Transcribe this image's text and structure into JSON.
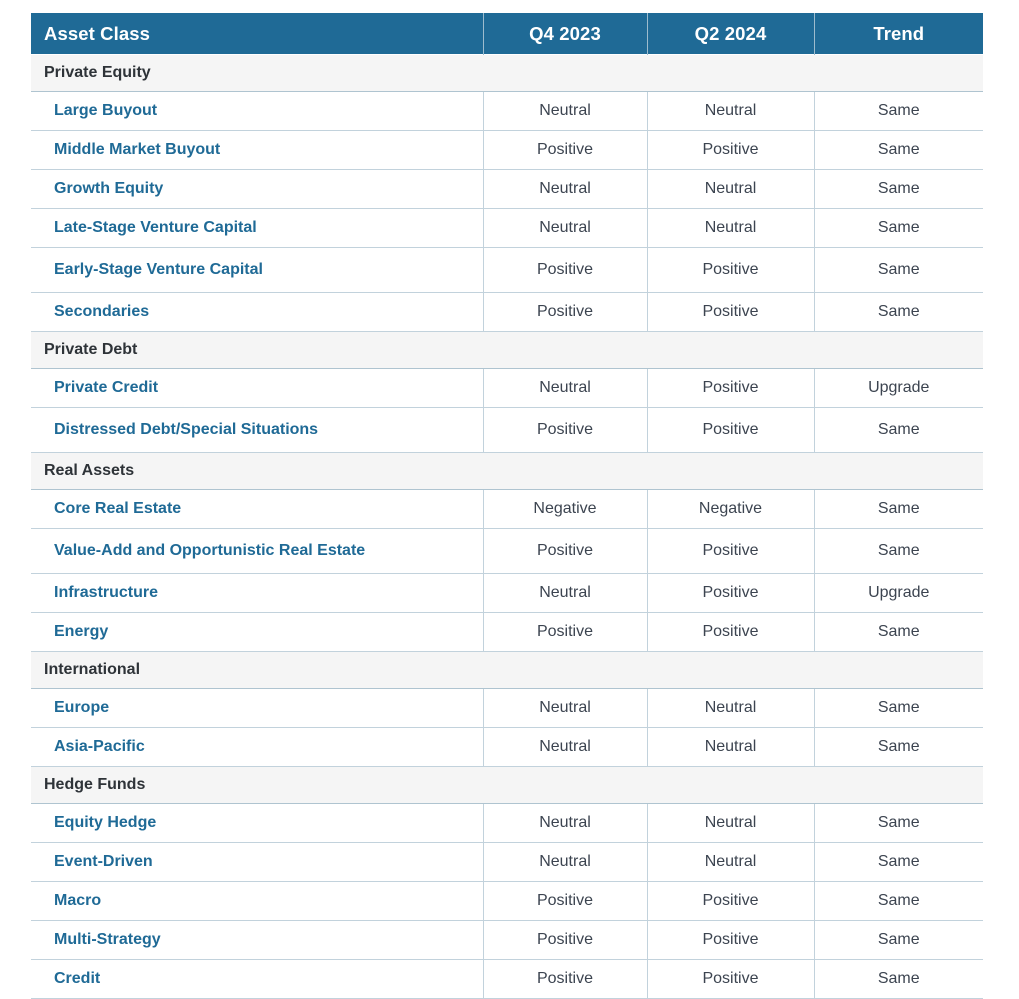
{
  "table": {
    "columns": [
      "Asset Class",
      "Q4 2023",
      "Q2 2024",
      "Trend"
    ],
    "header": {
      "asset_class": "Asset Class",
      "q4_2023": "Q4 2023",
      "q2_2024": "Q2 2024",
      "trend": "Trend"
    },
    "colors": {
      "header_background": "#1F6A96",
      "header_text": "#FFFFFF",
      "category_background": "#F5F5F5",
      "category_text": "#2E3338",
      "item_text": "#1F6A96",
      "value_text": "#3C4450",
      "row_border": "#C2D2DC"
    },
    "groups": [
      {
        "name": "Private Equity",
        "rows": [
          {
            "asset_class": "Large Buyout",
            "q4_2023": "Neutral",
            "q2_2024": "Neutral",
            "trend": "Same"
          },
          {
            "asset_class": "Middle Market Buyout",
            "q4_2023": "Positive",
            "q2_2024": "Positive",
            "trend": "Same"
          },
          {
            "asset_class": "Growth Equity",
            "q4_2023": "Neutral",
            "q2_2024": "Neutral",
            "trend": "Same"
          },
          {
            "asset_class": "Late-Stage Venture Capital",
            "q4_2023": "Neutral",
            "q2_2024": "Neutral",
            "trend": "Same"
          },
          {
            "asset_class": "Early-Stage Venture Capital",
            "q4_2023": "Positive",
            "q2_2024": "Positive",
            "trend": "Same"
          },
          {
            "asset_class": "Secondaries",
            "q4_2023": "Positive",
            "q2_2024": "Positive",
            "trend": "Same"
          }
        ]
      },
      {
        "name": "Private Debt",
        "rows": [
          {
            "asset_class": "Private Credit",
            "q4_2023": "Neutral",
            "q2_2024": "Positive",
            "trend": "Upgrade"
          },
          {
            "asset_class": "Distressed Debt/Special Situations",
            "q4_2023": "Positive",
            "q2_2024": "Positive",
            "trend": "Same"
          }
        ]
      },
      {
        "name": "Real Assets",
        "rows": [
          {
            "asset_class": "Core Real Estate",
            "q4_2023": "Negative",
            "q2_2024": "Negative",
            "trend": "Same"
          },
          {
            "asset_class": "Value-Add and Opportunistic Real Estate",
            "q4_2023": "Positive",
            "q2_2024": "Positive",
            "trend": "Same"
          },
          {
            "asset_class": "Infrastructure",
            "q4_2023": "Neutral",
            "q2_2024": "Positive",
            "trend": "Upgrade"
          },
          {
            "asset_class": "Energy",
            "q4_2023": "Positive",
            "q2_2024": "Positive",
            "trend": "Same"
          }
        ]
      },
      {
        "name": "International",
        "rows": [
          {
            "asset_class": "Europe",
            "q4_2023": "Neutral",
            "q2_2024": "Neutral",
            "trend": "Same"
          },
          {
            "asset_class": "Asia-Pacific",
            "q4_2023": "Neutral",
            "q2_2024": "Neutral",
            "trend": "Same"
          }
        ]
      },
      {
        "name": "Hedge Funds",
        "rows": [
          {
            "asset_class": "Equity Hedge",
            "q4_2023": "Neutral",
            "q2_2024": "Neutral",
            "trend": "Same"
          },
          {
            "asset_class": "Event-Driven",
            "q4_2023": "Neutral",
            "q2_2024": "Neutral",
            "trend": "Same"
          },
          {
            "asset_class": "Macro",
            "q4_2023": "Positive",
            "q2_2024": "Positive",
            "trend": "Same"
          },
          {
            "asset_class": "Multi-Strategy",
            "q4_2023": "Positive",
            "q2_2024": "Positive",
            "trend": "Same"
          },
          {
            "asset_class": "Credit",
            "q4_2023": "Positive",
            "q2_2024": "Positive",
            "trend": "Same"
          }
        ]
      }
    ]
  }
}
